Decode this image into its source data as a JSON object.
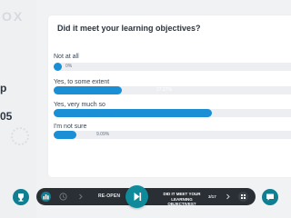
{
  "brand": {
    "logo_text": "OX"
  },
  "left_panel": {
    "fragment_a": "p",
    "fragment_b": "05"
  },
  "poll": {
    "question": "Did it meet your learning objectives?",
    "options": [
      {
        "label": "Not at all",
        "percent": 0,
        "percent_text": "0%"
      },
      {
        "label": "Yes, to some extent",
        "percent": 27.27,
        "percent_text": "27.27%"
      },
      {
        "label": "Yes, very much so",
        "percent": 63.63,
        "percent_text": ""
      },
      {
        "label": "I'm not sure",
        "percent": 9.09,
        "percent_text": "9.09%"
      }
    ],
    "accent_color": "#1a8fd6"
  },
  "toolbar": {
    "reopen_label": "RE-OPEN",
    "current_question_line1": "DID IT MEET YOUR",
    "current_question_line2": "LEARNING OBJECTIVES?",
    "counter": "3/17"
  },
  "icons": {
    "trophy": "trophy-icon",
    "stats": "bar-chart-icon",
    "timer": "timer-icon",
    "prev": "chevron-right-icon",
    "play": "play-next-icon",
    "chevron_next": "chevron-right-icon",
    "grid": "grid-icon",
    "chat": "chat-icon"
  }
}
